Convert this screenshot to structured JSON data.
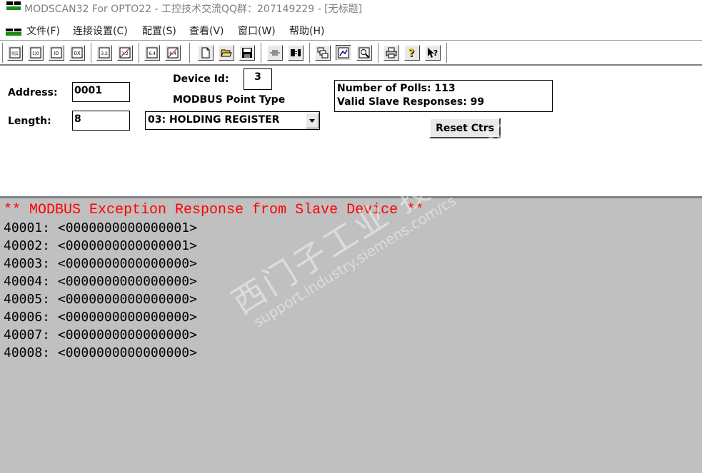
{
  "window": {
    "title": "MODSCAN32 For OPTO22 - 工控技术交流QQ群：207149229 - [无标题]"
  },
  "menu": [
    {
      "label": "文件(F)"
    },
    {
      "label": "连接设置(C)"
    },
    {
      "label": "配置(S)"
    },
    {
      "label": "查看(V)"
    },
    {
      "label": "窗口(W)"
    },
    {
      "label": "帮助(H)"
    }
  ],
  "toolbar": {
    "buttons": [
      {
        "icon": "coil-01-icon",
        "glyph": "0|1"
      },
      {
        "icon": "coil-10-icon",
        "glyph": "1|0"
      },
      {
        "icon": "input-status-icon",
        "glyph": "I0"
      },
      {
        "icon": "register-ox-icon",
        "glyph": "0X"
      },
      {
        "icon": "format-32-icon",
        "glyph": "3.2"
      },
      {
        "icon": "format-32-swap-icon",
        "glyph": "3.2"
      },
      {
        "icon": "format-64-icon",
        "glyph": "6.4"
      },
      {
        "icon": "format-64-swap-icon",
        "glyph": "6.4"
      },
      {
        "icon": "new-file-icon"
      },
      {
        "icon": "open-folder-icon"
      },
      {
        "icon": "save-icon"
      },
      {
        "icon": "connect-icon"
      },
      {
        "icon": "disconnect-icon"
      },
      {
        "icon": "display-config-icon"
      },
      {
        "icon": "traffic-display-icon"
      },
      {
        "icon": "zoom-icon"
      },
      {
        "icon": "print-icon"
      },
      {
        "icon": "help-icon",
        "glyph": "?"
      },
      {
        "icon": "context-help-icon",
        "glyph": "?"
      }
    ]
  },
  "config": {
    "address_label": "Address:",
    "address_value": "0001",
    "length_label": "Length:",
    "length_value": "8",
    "device_id_label": "Device Id:",
    "device_id_value": "3",
    "point_type_label": "MODBUS Point Type",
    "point_type_value": "03: HOLDING REGISTER",
    "polls_text": "Number of Polls: 113",
    "responses_text": "Valid Slave Responses: 99",
    "reset_label": "Reset Ctrs"
  },
  "data": {
    "exception": "** MODBUS Exception Response from Slave Device **",
    "rows": [
      "40001: <0000000000000001>",
      "40002: <0000000000000001>",
      "40003: <0000000000000000>",
      "40004: <0000000000000000>",
      "40005: <0000000000000000>",
      "40006: <0000000000000000>",
      "40007: <0000000000000000>",
      "40008: <0000000000000000>"
    ]
  },
  "watermark": {
    "line1": "西门子工业 技术论坛",
    "line2": "support.industry.siemens.com/cs"
  },
  "colors": {
    "exception_text": "#ff0000",
    "data_background": "#c0c0c0"
  }
}
